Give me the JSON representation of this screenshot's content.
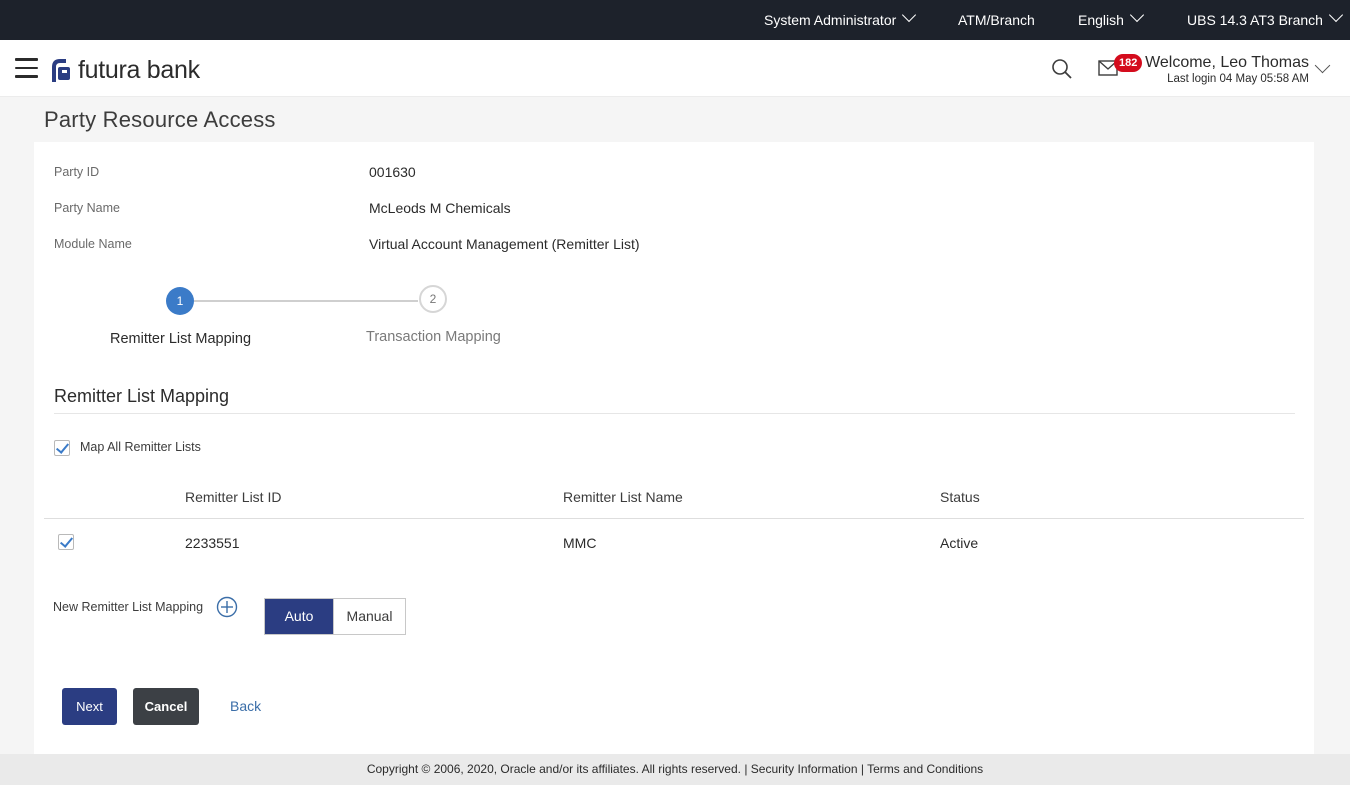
{
  "topbar": {
    "role": "System Administrator",
    "branch": "ATM/Branch",
    "language": "English",
    "entity": "UBS 14.3 AT3 Branch"
  },
  "header": {
    "logo_text": "futura bank",
    "notification_count": "182",
    "welcome": "Welcome, Leo Thomas",
    "last_login": "Last login 04 May 05:58 AM"
  },
  "page": {
    "title": "Party Resource Access"
  },
  "details": {
    "party_id_label": "Party ID",
    "party_id": "001630",
    "party_name_label": "Party Name",
    "party_name": "McLeods M Chemicals",
    "module_name_label": "Module Name",
    "module_name": "Virtual Account Management (Remitter List)"
  },
  "stepper": {
    "steps": [
      {
        "number": "1",
        "label": "Remitter List Mapping",
        "active": true
      },
      {
        "number": "2",
        "label": "Transaction Mapping",
        "active": false
      }
    ]
  },
  "section": {
    "title": "Remitter List Mapping",
    "map_all_label": "Map All Remitter Lists"
  },
  "table": {
    "columns": [
      "Remitter List ID",
      "Remitter List Name",
      "Status"
    ],
    "rows": [
      {
        "id": "2233551",
        "name": "MMC",
        "status": "Active",
        "checked": true
      }
    ]
  },
  "new_mapping": {
    "label": "New Remitter List Mapping",
    "options": [
      "Auto",
      "Manual"
    ],
    "selected": "Auto"
  },
  "actions": {
    "next": "Next",
    "cancel": "Cancel",
    "back": "Back"
  },
  "footer": {
    "copyright": "Copyright © 2006, 2020, Oracle and/or its affiliates. All rights reserved.",
    "sep": "|",
    "security": "Security Information",
    "terms": "Terms and Conditions"
  },
  "colors": {
    "topbar": "#1d222b",
    "primary": "#2b3d82",
    "accent": "#3b7bc8",
    "badge": "#d40c1d"
  }
}
